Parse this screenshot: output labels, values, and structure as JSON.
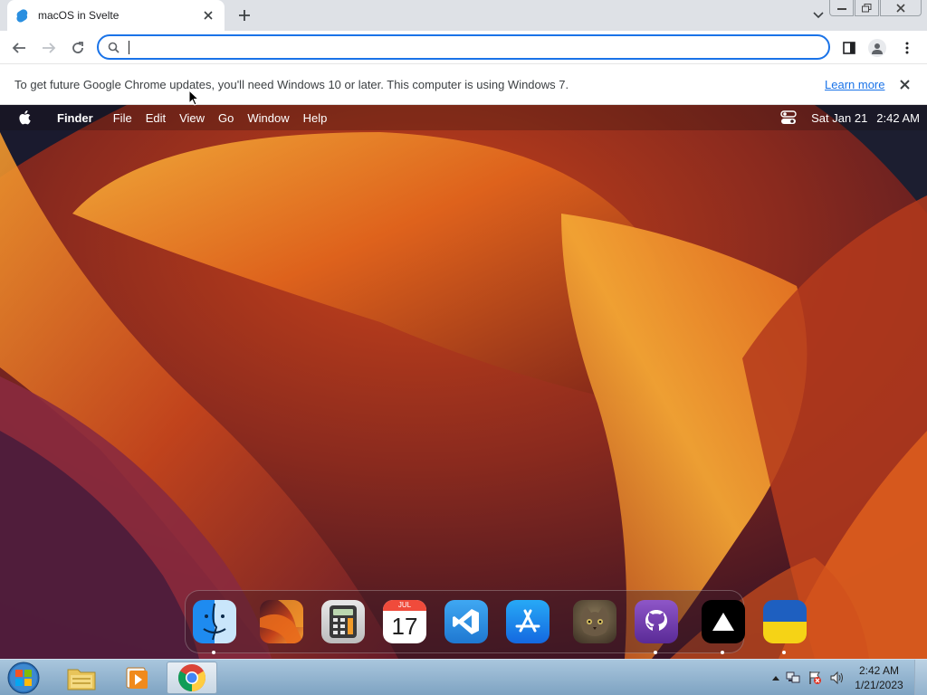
{
  "browser": {
    "tab_title": "macOS in Svelte",
    "omnibox_value": "",
    "omnibox_placeholder": ""
  },
  "infobar": {
    "message": "To get future Google Chrome updates, you'll need Windows 10 or later. This computer is using Windows 7.",
    "link": "Learn more"
  },
  "mac": {
    "menubar": {
      "app_name": "Finder",
      "items": [
        "File",
        "Edit",
        "View",
        "Go",
        "Window",
        "Help"
      ],
      "date": "Sat Jan 21",
      "time": "2:42 AM"
    },
    "calendar": {
      "month": "JUL",
      "day": "17"
    },
    "dock": [
      {
        "name": "finder",
        "running": true
      },
      {
        "name": "wallpapers",
        "running": false
      },
      {
        "name": "calculator",
        "running": false
      },
      {
        "name": "calendar",
        "running": false
      },
      {
        "name": "vscode",
        "running": false
      },
      {
        "name": "app-store",
        "running": false
      },
      {
        "name": "purrfect",
        "running": false
      },
      {
        "name": "github",
        "running": true
      },
      {
        "name": "vercel",
        "running": true
      },
      {
        "name": "ukraine",
        "running": true
      }
    ]
  },
  "taskbar": {
    "time": "2:42 AM",
    "date": "1/21/2023"
  },
  "colors": {
    "accent": "#1a73e8",
    "taskbar": "#a9c6dd"
  }
}
